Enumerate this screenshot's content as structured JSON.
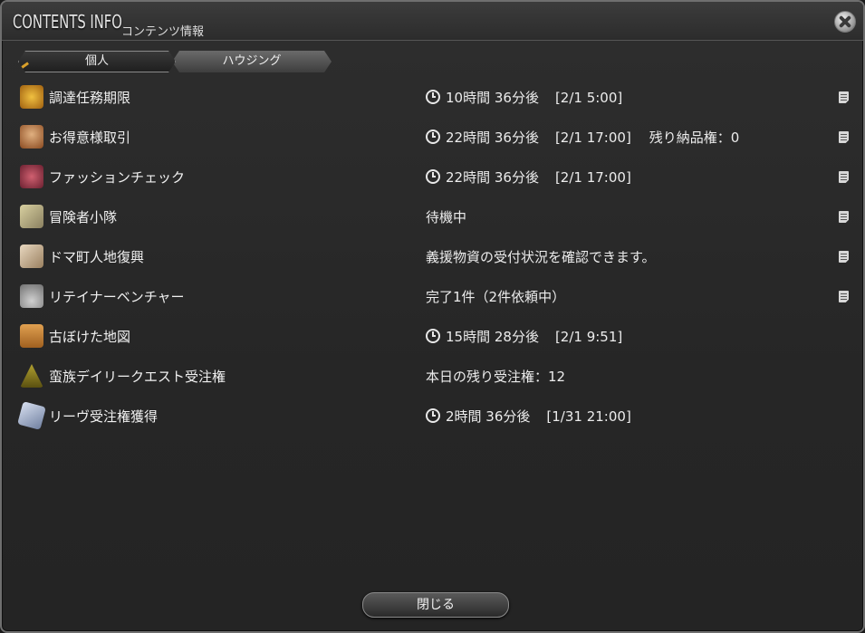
{
  "window": {
    "title_en": "CONTENTS INFO",
    "title_ja": "コンテンツ情報"
  },
  "tabs": [
    {
      "label": "個人",
      "active": true
    },
    {
      "label": "ハウジング",
      "active": false
    }
  ],
  "rows": [
    {
      "icon": "procurement-icon",
      "name": "調達任務期限",
      "has_clock": true,
      "status": "10時間 36分後",
      "date": "[2/1 5:00]",
      "extra": ""
    },
    {
      "icon": "custom-delivery-icon",
      "name": "お得意様取引",
      "has_clock": true,
      "status": "22時間 36分後",
      "date": "[2/1 17:00]",
      "extra": "残り納品権：0"
    },
    {
      "icon": "fashion-rose-icon",
      "name": "ファッションチェック",
      "has_clock": true,
      "status": "22時間 36分後",
      "date": "[2/1 17:00]",
      "extra": ""
    },
    {
      "icon": "squadron-scroll-icon",
      "name": "冒険者小隊",
      "has_clock": false,
      "status": "待機中",
      "date": "",
      "extra": ""
    },
    {
      "icon": "doman-restoration-icon",
      "name": "ドマ町人地復興",
      "has_clock": false,
      "status": "義援物資の受付状況を確認できます。",
      "date": "",
      "extra": ""
    },
    {
      "icon": "retainer-bell-icon",
      "name": "リテイナーベンチャー",
      "has_clock": false,
      "status": "完了1件（2件依頼中）",
      "date": "",
      "extra": ""
    },
    {
      "icon": "treasure-map-icon",
      "name": "古ぼけた地図",
      "has_clock": true,
      "status": "15時間 28分後",
      "date": "[2/1 9:51]",
      "extra": ""
    },
    {
      "icon": "tribal-quest-icon",
      "name": "蛮族デイリークエスト受注権",
      "has_clock": false,
      "status": "本日の残り受注権：12",
      "date": "",
      "extra": ""
    },
    {
      "icon": "levequest-card-icon",
      "name": "リーヴ受注権獲得",
      "has_clock": true,
      "status": "2時間 36分後",
      "date": "[1/31 21:00]",
      "extra": ""
    }
  ],
  "footer": {
    "close_label": "閉じる"
  }
}
